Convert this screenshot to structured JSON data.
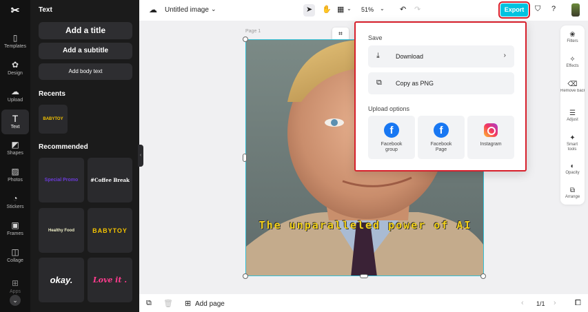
{
  "left_rail": {
    "logo": "✂",
    "items": [
      {
        "label": "Templates",
        "icon": "templates-icon"
      },
      {
        "label": "Design",
        "icon": "design-icon"
      },
      {
        "label": "Upload",
        "icon": "upload-icon"
      },
      {
        "label": "Text",
        "icon": "text-icon"
      },
      {
        "label": "Shapes",
        "icon": "shapes-icon"
      },
      {
        "label": "Photos",
        "icon": "photos-icon"
      },
      {
        "label": "Stickers",
        "icon": "stickers-icon"
      },
      {
        "label": "Frames",
        "icon": "frames-icon"
      },
      {
        "label": "Collage",
        "icon": "collage-icon"
      },
      {
        "label": "Apps",
        "icon": "apps-icon"
      }
    ],
    "active": "Text"
  },
  "text_panel": {
    "title": "Text",
    "add_title": "Add a title",
    "add_subtitle": "Add a subtitle",
    "add_body": "Add body text",
    "recents_title": "Recents",
    "recents": [
      "BABYTOY"
    ],
    "recommended_title": "Recommended",
    "recommended": [
      "Special Promo",
      "#Coffee Break",
      "Healthy Food",
      "BABYTOY",
      "okay.",
      "Love it ."
    ]
  },
  "topbar": {
    "doc_title": "Untitled image",
    "zoom": "51%",
    "export_label": "Export"
  },
  "canvas": {
    "page_label": "Page 1",
    "caption": "The unparalleled power of AI"
  },
  "right_tools": {
    "items": [
      "Filters",
      "Effects",
      "Remove backgr...",
      "Adjust",
      "Smart tools",
      "Opacity",
      "Arrange"
    ]
  },
  "bottombar": {
    "add_page": "Add page",
    "page_counter": "1/1"
  },
  "export_menu": {
    "save_title": "Save",
    "download": "Download",
    "copy_png": "Copy as PNG",
    "upload_title": "Upload options",
    "options": [
      "Facebook group",
      "Facebook Page",
      "Instagram"
    ]
  },
  "colors": {
    "accent": "#00c3e0",
    "highlight": "#d71f2b",
    "facebook": "#1877f2"
  }
}
